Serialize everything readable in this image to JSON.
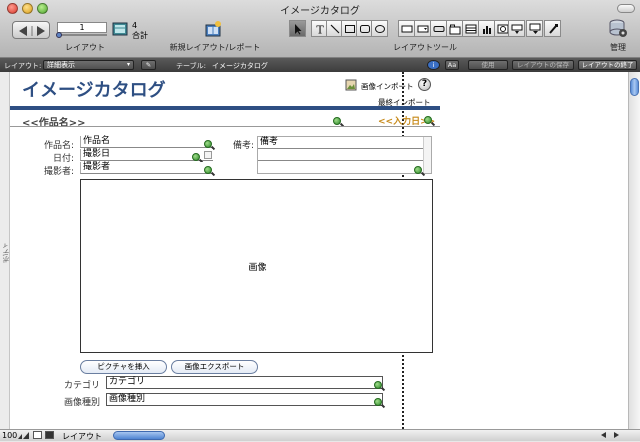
{
  "window": {
    "title": "イメージカタログ"
  },
  "toolbar": {
    "record_value": "1",
    "record_count": "4",
    "record_total_label": "合計",
    "layout_label": "レイアウト",
    "new_layout_label": "新規レイアウト/レポート",
    "layout_tools_label": "レイアウトツール",
    "manage_label": "管理"
  },
  "layoutbar": {
    "layout_prefix": "レイアウト:",
    "layout_value": "詳細表示",
    "table_prefix": "テーブル:",
    "table_value": "イメージカタログ",
    "aa_label": "Aa",
    "apply_label": "使用",
    "save_layout_label": "レイアウトの保存",
    "exit_layout_label": "レイアウトの終了"
  },
  "layout": {
    "heading": "イメージカタログ",
    "image_import_label": "画像インポート",
    "last_import_label": "最終インポート",
    "item_name_merge": "<<作品名>>",
    "input_date_merge": "<<入力日>>",
    "side_label": "ボディ",
    "fields": {
      "item_name_label": "作品名:",
      "item_name_value": "作品名",
      "date_label": "日付:",
      "date_value": "撮影日",
      "photographer_label": "撮影者:",
      "photographer_value": "撮影者",
      "notes_label": "備考:",
      "notes_value": "備考",
      "image_value": "画像",
      "category_label": "カテゴリ",
      "category_value": "カテゴリ",
      "image_type_label": "画像種別",
      "image_type_value": "画像種別"
    },
    "insert_picture_button": "ピクチャを挿入",
    "export_image_button": "画像エクスポート"
  },
  "statusbar": {
    "zoom": "100",
    "mode": "レイアウト"
  }
}
